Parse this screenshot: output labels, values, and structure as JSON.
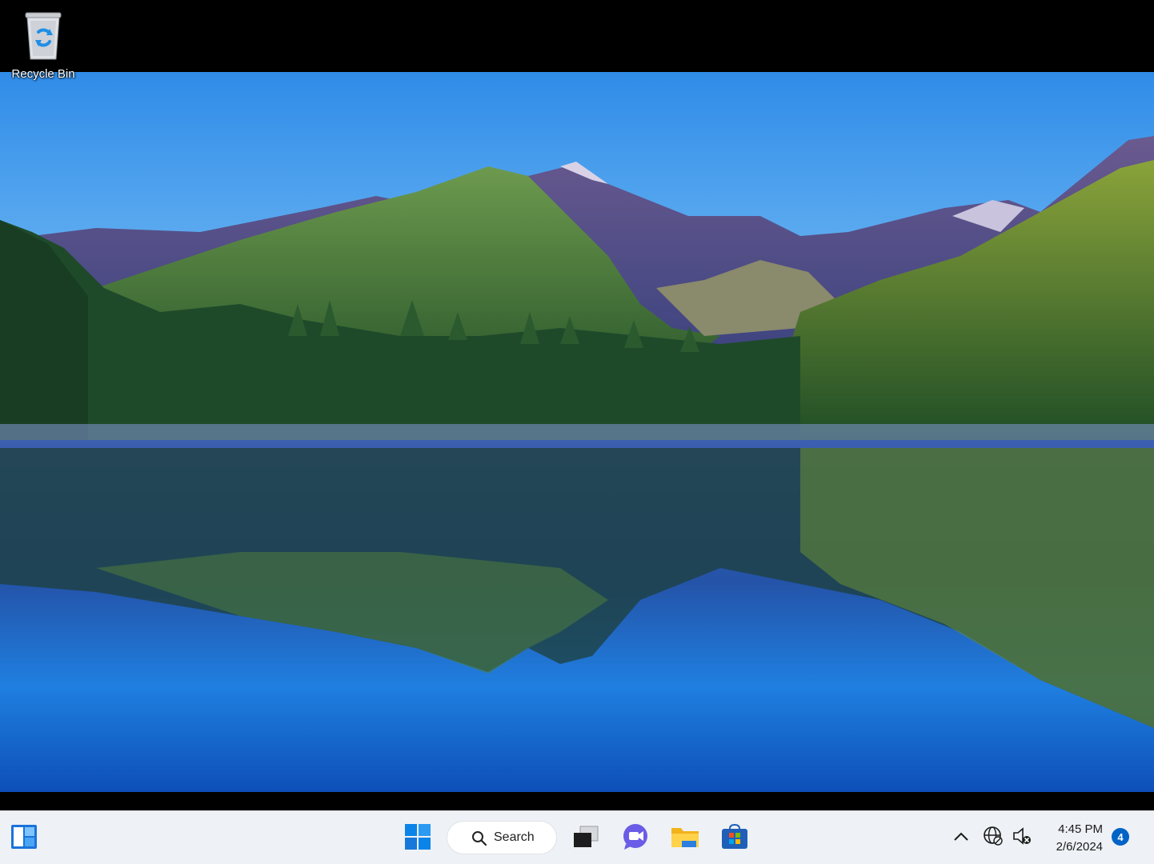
{
  "desktop": {
    "icons": [
      {
        "label": "Recycle Bin",
        "icon": "recycle-bin-icon"
      }
    ]
  },
  "taskbar": {
    "widgets_icon": "widgets-icon",
    "start_icon": "windows-start-icon",
    "search": {
      "label": "Search",
      "icon": "search-icon"
    },
    "pinned": [
      {
        "name": "task-view",
        "icon": "task-view-icon"
      },
      {
        "name": "teams-chat",
        "icon": "chat-icon"
      },
      {
        "name": "file-explorer",
        "icon": "folder-icon"
      },
      {
        "name": "microsoft-store",
        "icon": "store-icon"
      }
    ],
    "tray": {
      "overflow_icon": "chevron-up-icon",
      "network_icon": "globe-network-icon",
      "volume_icon": "volume-muted-icon",
      "time": "4:45 PM",
      "date": "2/6/2024",
      "notification_count": "4"
    },
    "colors": {
      "accent": "#0063c6",
      "taskbar_bg": "#eef1f5"
    }
  }
}
